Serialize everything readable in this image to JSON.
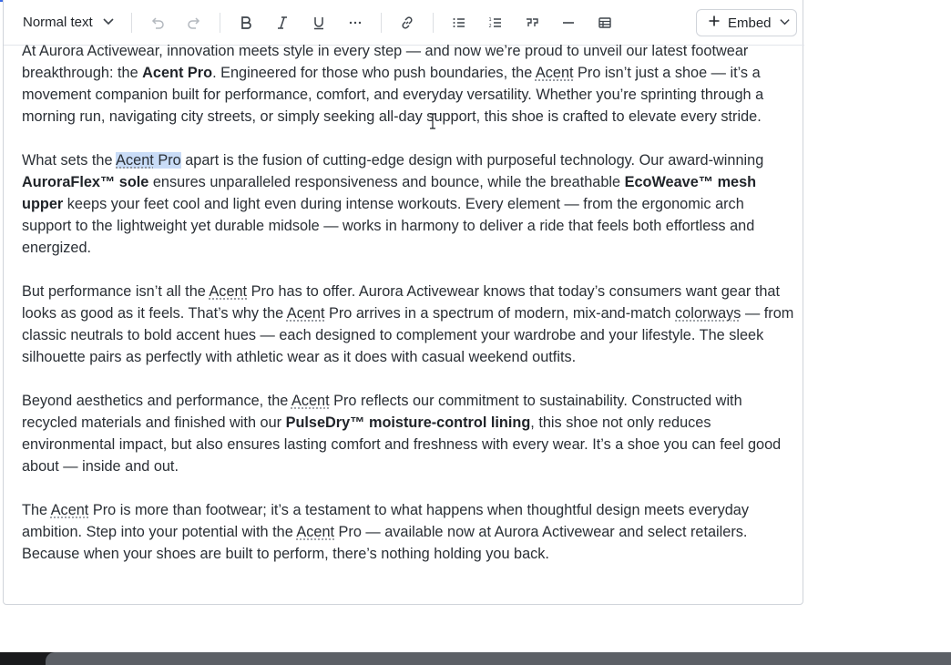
{
  "toolbar": {
    "block_format": "Normal text",
    "embed_label": "Embed"
  },
  "content": {
    "p1": {
      "a": "At Aurora Activewear, innovation meets style in every step — and now we’re proud to unveil our latest footwear breakthrough: the ",
      "b": "Acent Pro",
      "c": ". Engineered for those who push boundaries, the ",
      "d": "Acent",
      "e": " Pro isn’t just a shoe — it’s a movement companion built for performance, comfort, and everyday versatility. Whether you’re sprinting through a morning run, navigating city streets, or simply seeking all-day support, this shoe is crafted to elevate every stride."
    },
    "p2": {
      "a": "What sets the ",
      "b": "Acent",
      "c": " Pro",
      "d": " apart is the fusion of cutting-edge design with purposeful technology. Our award-winning ",
      "e": "AuroraFlex™ sole",
      "f": " ensures unparalleled responsiveness and bounce, while the breathable ",
      "g": "EcoWeave™ mesh upper",
      "h": " keeps your feet cool and light even during intense workouts. Every element — from the ergonomic arch support to the lightweight yet durable midsole — works in harmony to deliver a ride that feels both effortless and energized."
    },
    "p3": {
      "a": "But performance isn’t all the ",
      "b": "Acent",
      "c": " Pro has to offer. Aurora Activewear knows that today’s consumers want gear that looks as good as it feels. That’s why the ",
      "d": "Acent",
      "e": " Pro arrives in a spectrum of modern, mix-and-match ",
      "f": "colorways",
      "g": " — from classic neutrals to bold accent hues — each designed to complement your wardrobe and your lifestyle. The sleek silhouette pairs as perfectly with athletic wear as it does with casual weekend outfits."
    },
    "p4": {
      "a": "Beyond aesthetics and performance, the ",
      "b": "Acent",
      "c": " Pro reflects our commitment to sustainability. Constructed with recycled materials and finished with our ",
      "d": "PulseDry™ moisture-control lining",
      "e": ", this shoe not only reduces environmental impact, but also ensures lasting comfort and freshness with every wear. It’s a shoe you can feel good about — inside and out."
    },
    "p5": {
      "a": "The ",
      "b": "Acent",
      "c": " Pro is more than footwear; it’s a testament to what happens when thoughtful design meets everyday ambition. Step into your potential with the ",
      "d": "Acent",
      "e": " Pro — available now at Aurora Activewear and select retailers. Because when your shoes are built to perform, there’s nothing holding you back."
    }
  },
  "colors": {
    "accent": "#3b6ae6",
    "selection": "#c9dcf7",
    "border": "#d0d4da",
    "text": "#2a2f35"
  },
  "icons": [
    "chevron-down-icon",
    "undo-icon",
    "redo-icon",
    "bold-icon",
    "italic-icon",
    "underline-icon",
    "more-icon",
    "link-icon",
    "bullet-list-icon",
    "numbered-list-icon",
    "quote-icon",
    "divider-icon",
    "table-icon",
    "plus-icon",
    "text-cursor-icon"
  ]
}
